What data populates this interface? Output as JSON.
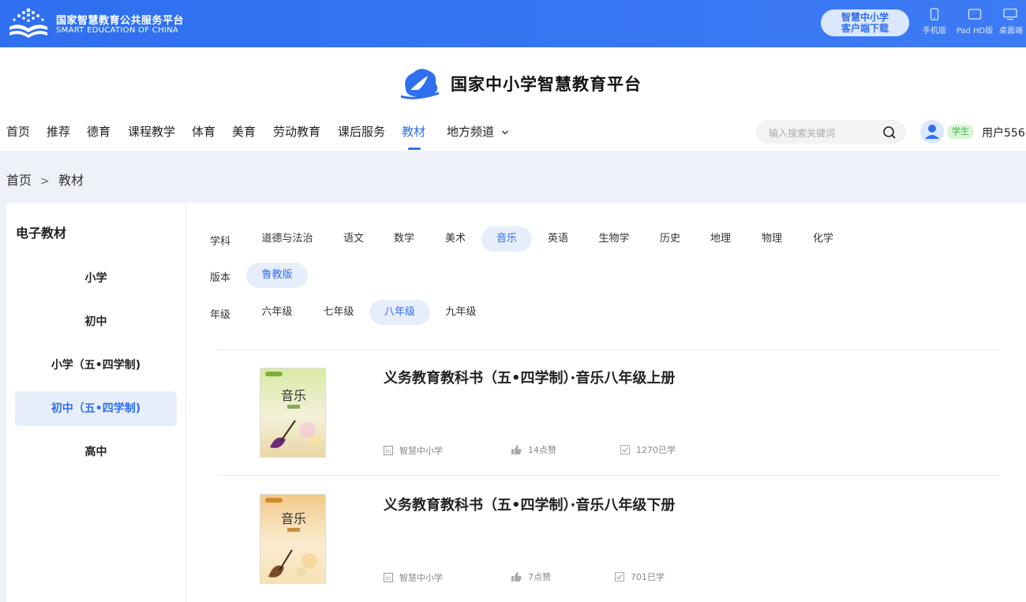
{
  "topbar": {
    "org_name": "国家智慧教育公共服务平台",
    "org_name_en": "SMART EDUCATION OF CHINA",
    "download": {
      "line1": "智慧中小学",
      "line2": "客户端下载"
    },
    "devices": [
      {
        "label": "手机版",
        "icon": "phone-icon"
      },
      {
        "label": "Pad HD版",
        "icon": "tablet-icon"
      },
      {
        "label": "桌面端",
        "icon": "desktop-icon"
      }
    ]
  },
  "header": {
    "site_title": "国家中小学智慧教育平台",
    "nav": [
      "首页",
      "推荐",
      "德育",
      "课程教学",
      "体育",
      "美育",
      "劳动教育",
      "课后服务",
      "教材",
      "地方频道"
    ],
    "active_nav": "教材",
    "search_placeholder": "输入搜索关键词",
    "user_role": "学生",
    "username": "用户556"
  },
  "breadcrumb": [
    "首页",
    ">",
    "教材"
  ],
  "sidebar": {
    "title": "电子教材",
    "items": [
      "小学",
      "初中",
      "小学（五•四学制)",
      "初中（五•四学制)",
      "高中"
    ],
    "active": "初中（五•四学制)"
  },
  "filters": {
    "subject_label": "学科",
    "subjects": [
      "道德与法治",
      "语文",
      "数学",
      "美术",
      "音乐",
      "英语",
      "生物学",
      "历史",
      "地理",
      "物理",
      "化学"
    ],
    "active_subject": "音乐",
    "edition_label": "版本",
    "editions": [
      "鲁教版"
    ],
    "active_edition": "鲁教版",
    "grade_label": "年级",
    "grades": [
      "六年级",
      "七年级",
      "八年级",
      "九年级"
    ],
    "active_grade": "八年级"
  },
  "books": [
    {
      "title": "义务教育教科书（五•四学制）·音乐八年级上册",
      "source": "智慧中小学",
      "likes": "14点赞",
      "learners": "1270已学",
      "cover_title": "音乐",
      "cover_colors": [
        "#d9e9a8",
        "#e9d6a6"
      ]
    },
    {
      "title": "义务教育教科书（五•四学制）·音乐八年级下册",
      "source": "智慧中小学",
      "likes": "7点赞",
      "learners": "701已学",
      "cover_title": "音乐",
      "cover_colors": [
        "#f2c98a",
        "#f7e2b5"
      ]
    }
  ],
  "colors": {
    "primary": "#2f6ff0",
    "active_bg": "#e7eefb",
    "student_badge": "#4caf50"
  }
}
